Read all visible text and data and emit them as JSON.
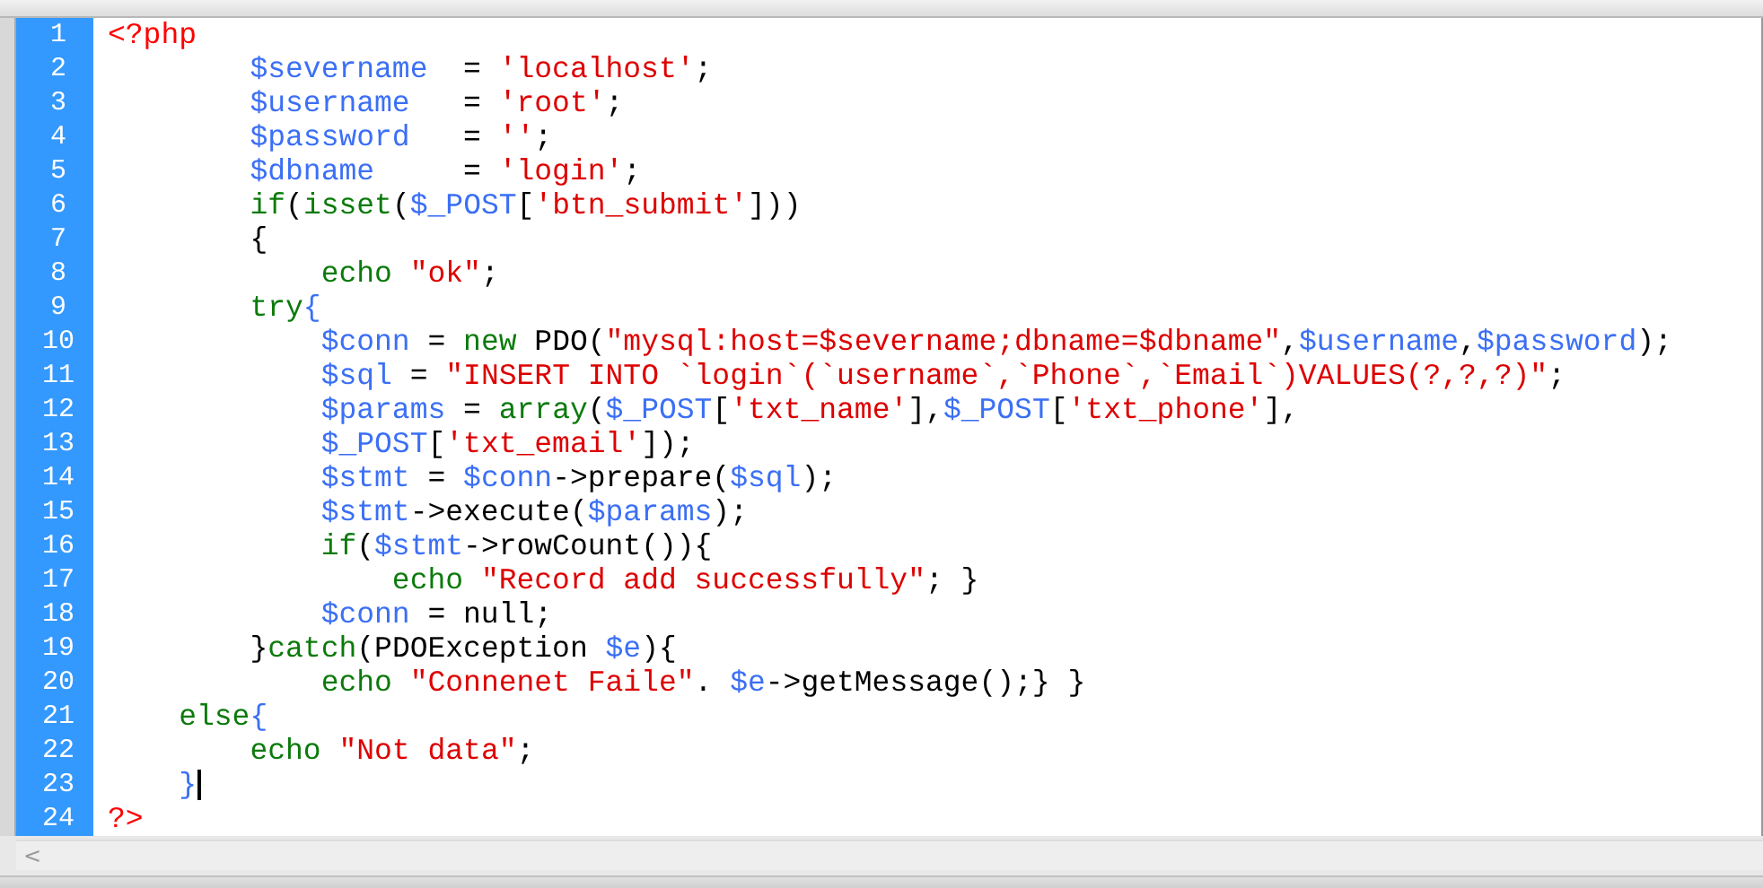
{
  "editor": {
    "lines": [
      {
        "number": "1",
        "cursor": false,
        "tokens": [
          {
            "kind": "tag",
            "text": "<?php"
          }
        ]
      },
      {
        "number": "2",
        "cursor": false,
        "tokens": [
          {
            "kind": "var",
            "text": "        $severname"
          },
          {
            "kind": "plain",
            "text": "  = "
          },
          {
            "kind": "str",
            "text": "'localhost'"
          },
          {
            "kind": "plain",
            "text": ";"
          }
        ]
      },
      {
        "number": "3",
        "cursor": false,
        "tokens": [
          {
            "kind": "var",
            "text": "        $username"
          },
          {
            "kind": "plain",
            "text": "   = "
          },
          {
            "kind": "str",
            "text": "'root'"
          },
          {
            "kind": "plain",
            "text": ";"
          }
        ]
      },
      {
        "number": "4",
        "cursor": false,
        "tokens": [
          {
            "kind": "var",
            "text": "        $password"
          },
          {
            "kind": "plain",
            "text": "   = "
          },
          {
            "kind": "str",
            "text": "''"
          },
          {
            "kind": "plain",
            "text": ";"
          }
        ]
      },
      {
        "number": "5",
        "cursor": false,
        "tokens": [
          {
            "kind": "var",
            "text": "        $dbname"
          },
          {
            "kind": "plain",
            "text": "     = "
          },
          {
            "kind": "str",
            "text": "'login'"
          },
          {
            "kind": "plain",
            "text": ";"
          }
        ]
      },
      {
        "number": "6",
        "cursor": false,
        "tokens": [
          {
            "kind": "kw",
            "text": "        if"
          },
          {
            "kind": "plain",
            "text": "("
          },
          {
            "kind": "kw",
            "text": "isset"
          },
          {
            "kind": "plain",
            "text": "("
          },
          {
            "kind": "var",
            "text": "$_POST"
          },
          {
            "kind": "plain",
            "text": "["
          },
          {
            "kind": "str",
            "text": "'btn_submit'"
          },
          {
            "kind": "plain",
            "text": "]))"
          }
        ]
      },
      {
        "number": "7",
        "cursor": false,
        "tokens": [
          {
            "kind": "plain",
            "text": "        {"
          }
        ]
      },
      {
        "number": "8",
        "cursor": false,
        "tokens": [
          {
            "kind": "kw",
            "text": "            echo"
          },
          {
            "kind": "str",
            "text": " \"ok\""
          },
          {
            "kind": "plain",
            "text": ";"
          }
        ]
      },
      {
        "number": "9",
        "cursor": false,
        "tokens": [
          {
            "kind": "kw",
            "text": "        try"
          },
          {
            "kind": "brace",
            "text": "{"
          }
        ]
      },
      {
        "number": "10",
        "cursor": false,
        "tokens": [
          {
            "kind": "var",
            "text": "            $conn"
          },
          {
            "kind": "plain",
            "text": " = "
          },
          {
            "kind": "kw",
            "text": "new"
          },
          {
            "kind": "plain",
            "text": " PDO("
          },
          {
            "kind": "str",
            "text": "\"mysql:host=$severname;dbname=$dbname\""
          },
          {
            "kind": "plain",
            "text": ","
          },
          {
            "kind": "var",
            "text": "$username"
          },
          {
            "kind": "plain",
            "text": ","
          },
          {
            "kind": "var",
            "text": "$password"
          },
          {
            "kind": "plain",
            "text": ");"
          }
        ]
      },
      {
        "number": "11",
        "cursor": false,
        "tokens": [
          {
            "kind": "var",
            "text": "            $sql"
          },
          {
            "kind": "plain",
            "text": " = "
          },
          {
            "kind": "str",
            "text": "\"INSERT INTO `login`(`username`,`Phone`,`Email`)VALUES(?,?,?)\""
          },
          {
            "kind": "plain",
            "text": ";"
          }
        ]
      },
      {
        "number": "12",
        "cursor": false,
        "tokens": [
          {
            "kind": "var",
            "text": "            $params"
          },
          {
            "kind": "plain",
            "text": " = "
          },
          {
            "kind": "kw",
            "text": "array"
          },
          {
            "kind": "plain",
            "text": "("
          },
          {
            "kind": "var",
            "text": "$_POST"
          },
          {
            "kind": "plain",
            "text": "["
          },
          {
            "kind": "str",
            "text": "'txt_name'"
          },
          {
            "kind": "plain",
            "text": "],"
          },
          {
            "kind": "var",
            "text": "$_POST"
          },
          {
            "kind": "plain",
            "text": "["
          },
          {
            "kind": "str",
            "text": "'txt_phone'"
          },
          {
            "kind": "plain",
            "text": "],"
          }
        ]
      },
      {
        "number": "13",
        "cursor": false,
        "tokens": [
          {
            "kind": "var",
            "text": "            $_POST"
          },
          {
            "kind": "plain",
            "text": "["
          },
          {
            "kind": "str",
            "text": "'txt_email'"
          },
          {
            "kind": "plain",
            "text": "]);"
          }
        ]
      },
      {
        "number": "14",
        "cursor": false,
        "tokens": [
          {
            "kind": "var",
            "text": "            $stmt"
          },
          {
            "kind": "plain",
            "text": " = "
          },
          {
            "kind": "var",
            "text": "$conn"
          },
          {
            "kind": "plain",
            "text": "->prepare("
          },
          {
            "kind": "var",
            "text": "$sql"
          },
          {
            "kind": "plain",
            "text": ");"
          }
        ]
      },
      {
        "number": "15",
        "cursor": false,
        "tokens": [
          {
            "kind": "var",
            "text": "            $stmt"
          },
          {
            "kind": "plain",
            "text": "->execute("
          },
          {
            "kind": "var",
            "text": "$params"
          },
          {
            "kind": "plain",
            "text": ");"
          }
        ]
      },
      {
        "number": "16",
        "cursor": false,
        "tokens": [
          {
            "kind": "kw",
            "text": "            if"
          },
          {
            "kind": "plain",
            "text": "("
          },
          {
            "kind": "var",
            "text": "$stmt"
          },
          {
            "kind": "plain",
            "text": "->rowCount()){"
          }
        ]
      },
      {
        "number": "17",
        "cursor": false,
        "tokens": [
          {
            "kind": "kw",
            "text": "                echo"
          },
          {
            "kind": "str",
            "text": " \"Record add successfully\""
          },
          {
            "kind": "plain",
            "text": "; }"
          }
        ]
      },
      {
        "number": "18",
        "cursor": false,
        "tokens": [
          {
            "kind": "var",
            "text": "            $conn"
          },
          {
            "kind": "plain",
            "text": " = null;"
          }
        ]
      },
      {
        "number": "19",
        "cursor": false,
        "tokens": [
          {
            "kind": "plain",
            "text": "        }"
          },
          {
            "kind": "kw",
            "text": "catch"
          },
          {
            "kind": "plain",
            "text": "(PDOException "
          },
          {
            "kind": "var",
            "text": "$e"
          },
          {
            "kind": "plain",
            "text": "){"
          }
        ]
      },
      {
        "number": "20",
        "cursor": false,
        "tokens": [
          {
            "kind": "kw",
            "text": "            echo"
          },
          {
            "kind": "str",
            "text": " \"Connenet Faile\""
          },
          {
            "kind": "plain",
            "text": ". "
          },
          {
            "kind": "var",
            "text": "$e"
          },
          {
            "kind": "plain",
            "text": "->getMessage();} }"
          }
        ]
      },
      {
        "number": "21",
        "cursor": false,
        "tokens": [
          {
            "kind": "kw",
            "text": "    else"
          },
          {
            "kind": "brace",
            "text": "{"
          }
        ]
      },
      {
        "number": "22",
        "cursor": false,
        "tokens": [
          {
            "kind": "kw",
            "text": "        echo"
          },
          {
            "kind": "str",
            "text": " \"Not data\""
          },
          {
            "kind": "plain",
            "text": ";"
          }
        ]
      },
      {
        "number": "23",
        "cursor": true,
        "tokens": [
          {
            "kind": "brace",
            "text": "    }"
          }
        ]
      },
      {
        "number": "24",
        "cursor": false,
        "tokens": [
          {
            "kind": "tag",
            "text": "?>"
          }
        ]
      }
    ],
    "scrollbar": {
      "arrow": "<"
    }
  }
}
